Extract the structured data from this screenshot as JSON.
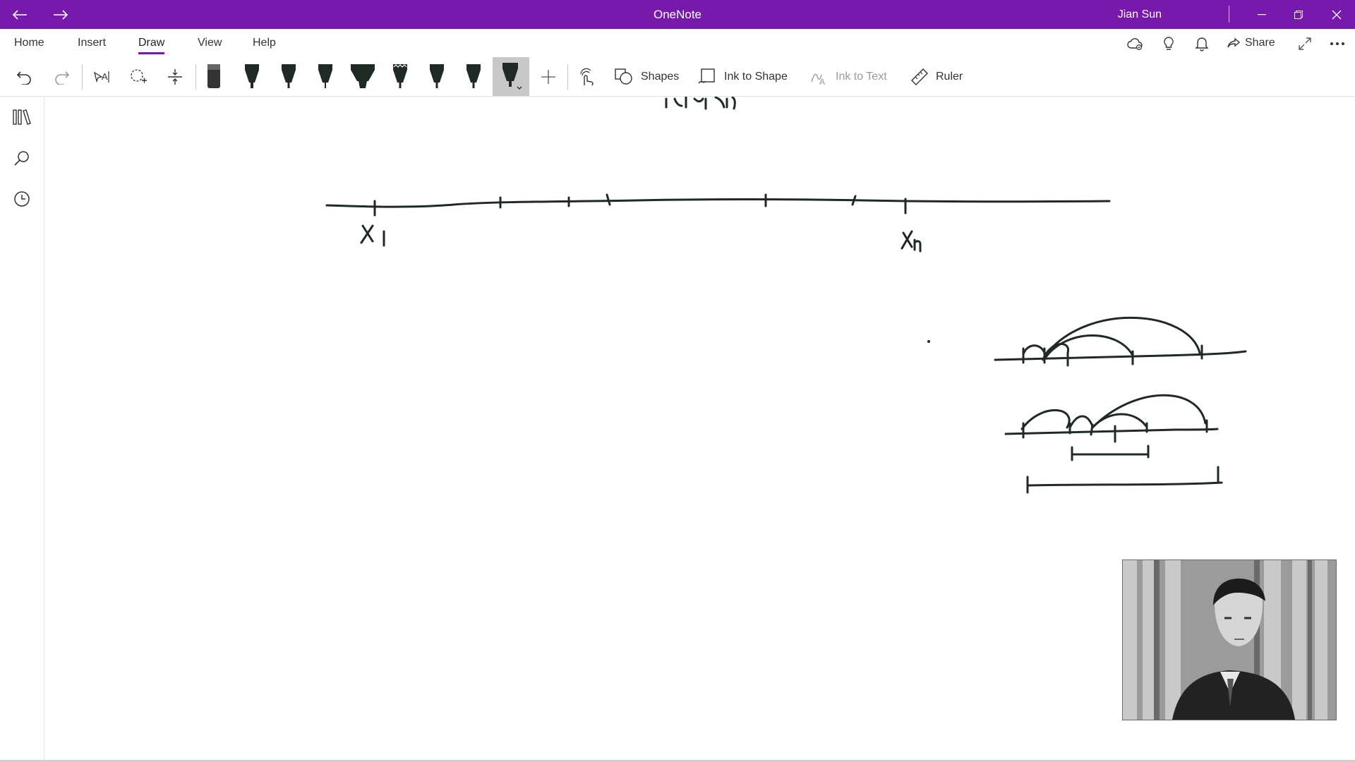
{
  "titlebar": {
    "app_title": "OneNote",
    "user_name": "Jian Sun",
    "back_icon": "back-arrow-icon",
    "forward_icon": "forward-arrow-icon",
    "minimize_icon": "minimize-icon",
    "restore_icon": "restore-icon",
    "close_icon": "close-icon"
  },
  "ribbon": {
    "tabs": [
      {
        "label": "Home"
      },
      {
        "label": "Insert"
      },
      {
        "label": "Draw",
        "active": true
      },
      {
        "label": "View"
      },
      {
        "label": "Help"
      }
    ],
    "right_icons": [
      "sync-status-icon",
      "lightbulb-icon",
      "notifications-bell-icon"
    ],
    "share_label": "Share",
    "fullscreen_icon": "expand-icon",
    "more_icon": "more-options-icon"
  },
  "toolbar": {
    "shapes_label": "Shapes",
    "ink_to_shape_label": "Ink to Shape",
    "ink_to_text_label": "Ink to Text",
    "ruler_label": "Ruler"
  },
  "rail": {
    "items": [
      "notebooks-icon",
      "search-icon",
      "recent-clock-icon"
    ]
  },
  "canvas": {
    "label_x1": "X",
    "label_x1_sub": "1",
    "label_xn": "X",
    "label_xn_sub": "n"
  },
  "colors": {
    "accent": "#7719aa",
    "ink": "#1f2a24"
  }
}
